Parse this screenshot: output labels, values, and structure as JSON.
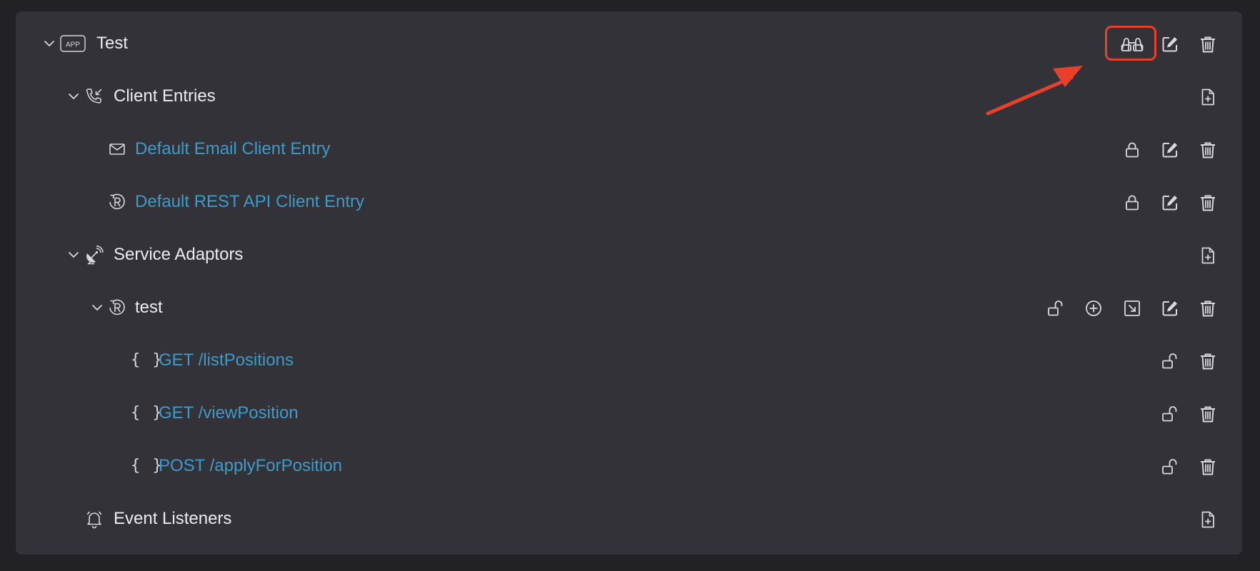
{
  "colors": {
    "background": "#222226",
    "panel": "#333238",
    "text": "#ececee",
    "link": "#3d9bc9",
    "icon": "#d8d8dc",
    "annotation": "#e8412b"
  },
  "tree": {
    "app": {
      "badge": "APP",
      "label": "Test",
      "icon": "app-badge-icon"
    },
    "client_entries": {
      "label": "Client Entries",
      "icon": "phone-incoming-icon",
      "items": [
        {
          "label": "Default Email Client Entry",
          "icon": "envelope-icon"
        },
        {
          "label": "Default REST API Client Entry",
          "icon": "rest-r-icon"
        }
      ]
    },
    "service_adaptors": {
      "label": "Service Adaptors",
      "icon": "satellite-dish-icon",
      "adaptor": {
        "label": "test",
        "icon": "rest-r-icon"
      },
      "operations": [
        {
          "braces": "{ }",
          "label": "GET /listPositions"
        },
        {
          "braces": "{ }",
          "label": "GET /viewPosition"
        },
        {
          "braces": "{ }",
          "label": "POST /applyForPosition"
        }
      ]
    },
    "event_listeners": {
      "label": "Event Listeners",
      "icon": "bell-icon"
    }
  }
}
